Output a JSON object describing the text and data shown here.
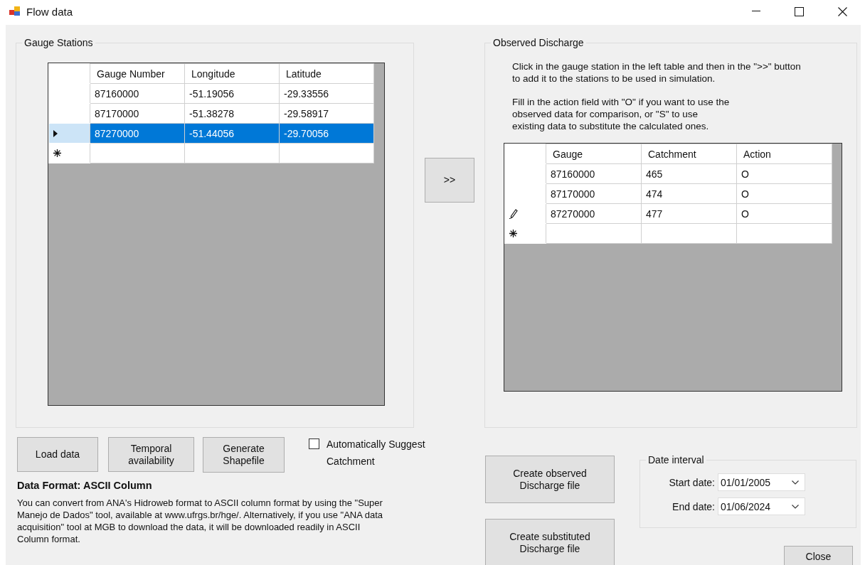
{
  "window": {
    "title": "Flow data"
  },
  "gauge_stations": {
    "title": "Gauge Stations",
    "allow_new_row": true,
    "columns": [
      "Gauge Number",
      "Longitude",
      "Latitude"
    ],
    "rows": [
      {
        "cells": [
          "87160000",
          "-51.19056",
          "-29.33556"
        ],
        "selected": false
      },
      {
        "cells": [
          "87170000",
          "-51.38278",
          "-29.58917"
        ],
        "selected": false
      },
      {
        "cells": [
          "87270000",
          "-51.44056",
          "-29.70056"
        ],
        "selected": true
      }
    ]
  },
  "add_button": ">>",
  "observed_discharge": {
    "title": "Observed Discharge",
    "instructions": [
      "Click in the gauge station in the left table and then in the \">>\" button\nto add it to the stations to be used in simulation.",
      "Fill in the action field with \"O\" if you want to use the\nobserved data for comparison, or \"S\" to use\nexisting data to substitute the calculated ones."
    ],
    "allow_new_row": true,
    "columns": [
      "Gauge",
      "Catchment",
      "Action"
    ],
    "rows": [
      {
        "cells": [
          "87160000",
          "465",
          "O"
        ],
        "editing": false
      },
      {
        "cells": [
          "87170000",
          "474",
          "O"
        ],
        "editing": false
      },
      {
        "cells": [
          "87270000",
          "477",
          "O"
        ],
        "editing": true
      }
    ]
  },
  "buttons": [
    "Load data",
    "Temporal availability",
    "Generate Shapefile"
  ],
  "auto_suggest": {
    "label": "Automatically Suggest Catchment",
    "checked": false
  },
  "data_format": {
    "heading": "Data Format: ASCII Column",
    "text": "You can convert from ANA's Hidroweb format to ASCII column format by using the \"Super Manejo de Dados\" tool, available at www.ufrgs.br/hge/. Alternatively, if you use \"ANA data acquisition\" tool at MGB to download the data, it will be downloaded readily in ASCII Column format."
  },
  "file_buttons": [
    "Create observed Discharge file",
    "Create substituted Discharge file"
  ],
  "date_interval": {
    "title": "Date interval",
    "fields": [
      {
        "label": "Start date:",
        "value": "01/01/2005"
      },
      {
        "label": "End date:",
        "value": "01/06/2024"
      }
    ]
  },
  "close_button": "Close"
}
